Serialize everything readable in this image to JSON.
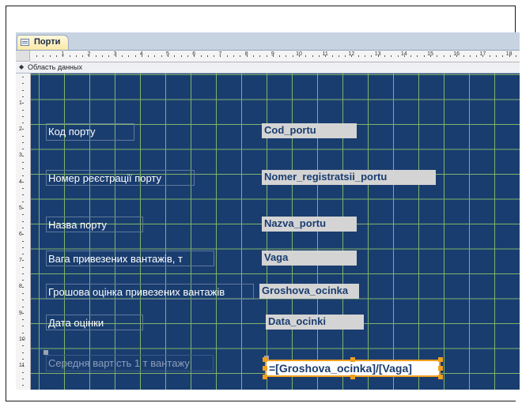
{
  "tab": {
    "title": "Порти",
    "icon": "form-icon"
  },
  "ruler": {
    "h_numbers": [
      "1",
      "2",
      "3",
      "4",
      "5",
      "6",
      "7",
      "8",
      "9",
      "10",
      "11",
      "12",
      "13",
      "14",
      "15",
      "16",
      "17",
      "18"
    ],
    "v_numbers": [
      "1",
      "2",
      "3",
      "4",
      "5",
      "6",
      "7",
      "8",
      "9",
      "10",
      "11"
    ]
  },
  "section": {
    "label": "Область данных",
    "icon": "collapse-arrow-icon"
  },
  "fields": [
    {
      "label": "Код порту",
      "control": "Cod_portu"
    },
    {
      "label": "Номер реєстрації порту",
      "control": "Nomer_registratsii_portu"
    },
    {
      "label": "Назва порту",
      "control": "Nazva_portu"
    },
    {
      "label": "Вага привезених вантажів, т",
      "control": "Vaga"
    },
    {
      "label": "Грошова оцінка привезених вантажів",
      "control": "Groshova_ocinka"
    },
    {
      "label": "Дата оцінки",
      "control": "Data_ocinki"
    },
    {
      "label": "Середня вартість 1 т вантажу",
      "control": "=[Groshova_ocinka]/[Vaga]"
    }
  ],
  "colors": {
    "canvas": "#1a3d70",
    "grid": "#7fb36a",
    "selection": "#f0a020",
    "tab": "#fbe9a8"
  }
}
